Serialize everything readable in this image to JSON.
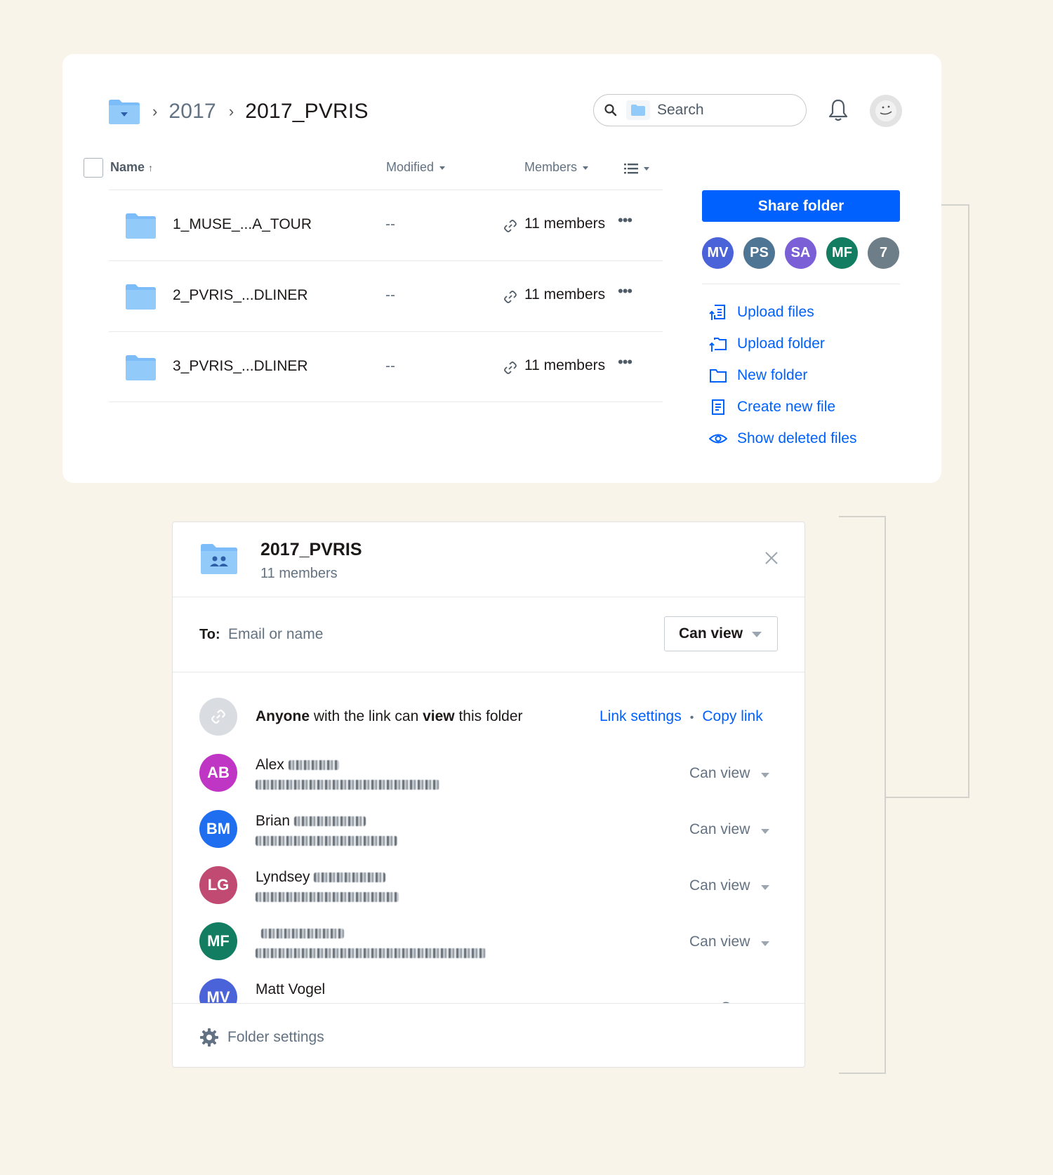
{
  "breadcrumb": {
    "items": [
      "2017",
      "2017_PVRIS"
    ]
  },
  "search": {
    "placeholder": "Search"
  },
  "table": {
    "headers": {
      "name": "Name",
      "modified": "Modified",
      "members": "Members"
    },
    "rows": [
      {
        "name": "1_MUSE_...A_TOUR",
        "modified": "--",
        "members": "11 members"
      },
      {
        "name": "2_PVRIS_...DLINER",
        "modified": "--",
        "members": "11 members"
      },
      {
        "name": "3_PVRIS_...DLINER",
        "modified": "--",
        "members": "11 members"
      }
    ]
  },
  "sidebar": {
    "share_label": "Share folder",
    "avatars": [
      {
        "initials": "MV",
        "color": "#4a63d9"
      },
      {
        "initials": "PS",
        "color": "#4e7594"
      },
      {
        "initials": "SA",
        "color": "#7b5fd6"
      },
      {
        "initials": "MF",
        "color": "#137d62"
      },
      {
        "initials": "7",
        "color": "#6e7e89"
      }
    ],
    "actions": [
      {
        "label": "Upload files",
        "icon": "upload-file-icon"
      },
      {
        "label": "Upload folder",
        "icon": "upload-folder-icon"
      },
      {
        "label": "New folder",
        "icon": "new-folder-icon"
      },
      {
        "label": "Create new file",
        "icon": "new-file-icon"
      },
      {
        "label": "Show deleted files",
        "icon": "eye-icon"
      }
    ]
  },
  "dialog": {
    "title": "2017_PVRIS",
    "subtitle": "11 members",
    "to_label": "To:",
    "to_placeholder": "Email or name",
    "permission": "Can view",
    "link_text": {
      "anyone": "Anyone",
      "mid": " with the link can ",
      "view": "view",
      "end": " this folder"
    },
    "link_settings": "Link settings",
    "copy_link": "Copy link",
    "people": [
      {
        "initials": "AB",
        "name": "Alex",
        "role": "Can view",
        "color": "#c036c4"
      },
      {
        "initials": "BM",
        "name": "Brian",
        "role": "Can view",
        "color": "#1f6ef0"
      },
      {
        "initials": "LG",
        "name": "Lyndsey",
        "role": "Can view",
        "color": "#c04a71"
      },
      {
        "initials": "MF",
        "name": "",
        "role": "Can view",
        "color": "#137d62"
      },
      {
        "initials": "MV",
        "name": "Matt Vogel",
        "role": "Owner",
        "color": "#4a63d9"
      }
    ],
    "footer": "Folder settings"
  },
  "colors": {
    "accent": "#0061fe",
    "background": "#f9f4ea"
  }
}
